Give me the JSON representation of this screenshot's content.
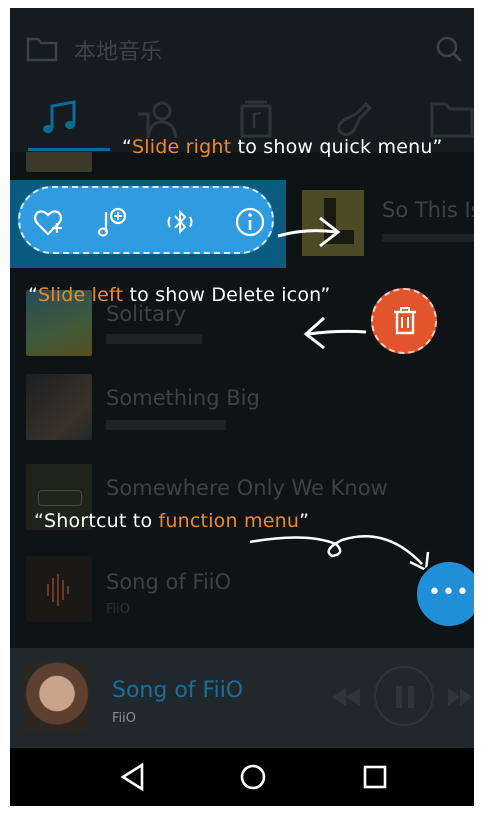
{
  "header": {
    "title": "本地音乐",
    "folder_icon": "folder-icon",
    "search_icon": "search-icon"
  },
  "tabs": [
    "music-note-icon",
    "artist-icon",
    "album-icon",
    "guitar-icon",
    "folder-icon"
  ],
  "songs": [
    {
      "title": "So This Is",
      "artist": ""
    },
    {
      "title": "Solitary",
      "artist": ""
    },
    {
      "title": "Something Big",
      "artist": ""
    },
    {
      "title": "Somewhere Only We Know",
      "artist": ""
    },
    {
      "title": "Song of FiiO",
      "artist": "FiiO"
    }
  ],
  "hints": {
    "quick": {
      "open_quote": "“",
      "highlight": "Slide right",
      "rest": " to show quick menu”"
    },
    "delete": {
      "open_quote": "“",
      "highlight": "Slide left",
      "rest": " to show Delete icon”"
    },
    "shortcut": {
      "prefix": "“Shortcut to ",
      "highlight": "function menu",
      "close_quote": "”"
    }
  },
  "quick_menu": [
    "heart-add-icon",
    "music-add-icon",
    "bluetooth-icon",
    "info-icon"
  ],
  "fab": {
    "label": "•••"
  },
  "now_playing": {
    "title": "Song of FiiO",
    "artist": "FiiO"
  },
  "colors": {
    "accent": "#f08a28",
    "blue": "#2f9be0",
    "delete": "#e2542b"
  }
}
